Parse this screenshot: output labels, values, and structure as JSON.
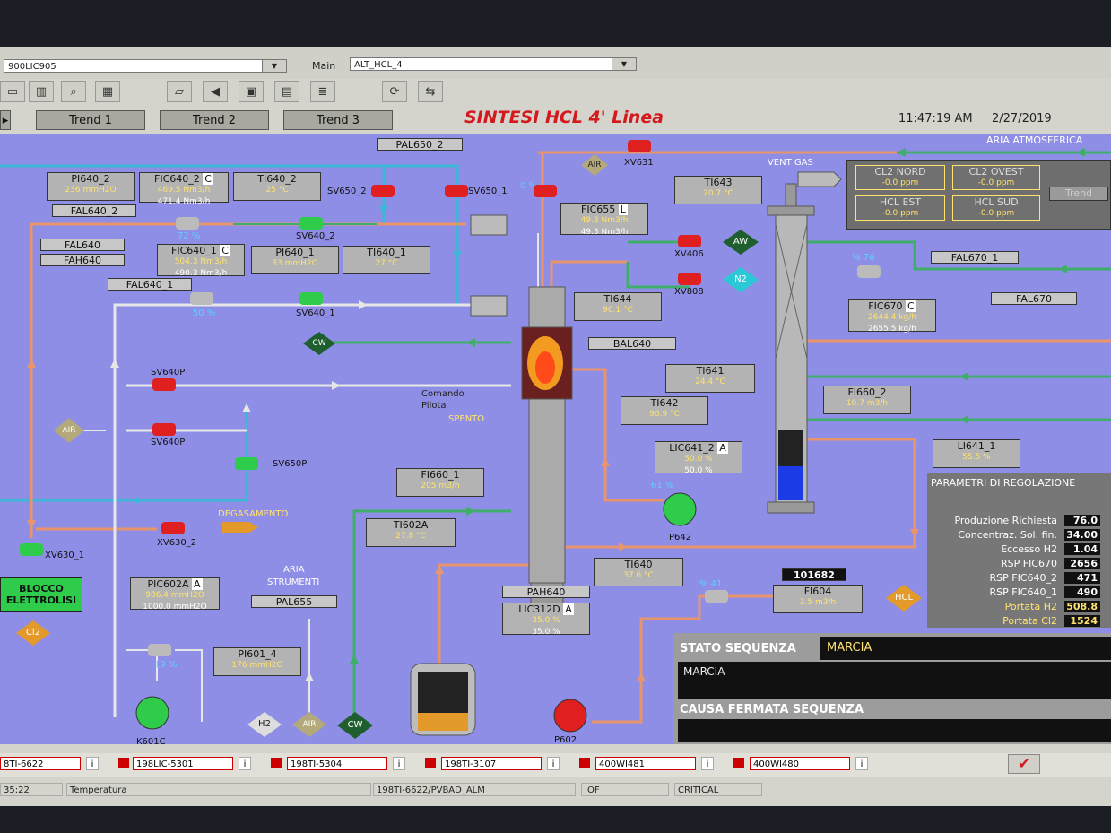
{
  "topbar": {
    "station_combo": "900LIC905",
    "main_label": "Main",
    "main_combo": "ALT_HCL_4"
  },
  "tabs": [
    "Trend 1",
    "Trend 2",
    "Trend 3"
  ],
  "title": "SINTESI HCL 4' Linea",
  "clock": {
    "time": "11:47:19 AM",
    "date": "2/27/2019"
  },
  "air_label": "ARIA ATMOSFERICA",
  "vent_label": "VENT GAS",
  "gas_box": {
    "cl2_nord": {
      "label": "CL2 NORD",
      "value": "-0.0 ppm"
    },
    "cl2_ovest": {
      "label": "CL2 OVEST",
      "value": "-0.0 ppm"
    },
    "hcl_est": {
      "label": "HCL EST",
      "value": "-0.0 ppm"
    },
    "hcl_sud": {
      "label": "HCL SUD",
      "value": "-0.0 ppm"
    },
    "trend_btn": "Trend"
  },
  "tags": {
    "pi640_2": {
      "name": "PI640_2",
      "value": "236 mmH2O"
    },
    "fic640_2": {
      "name": "FIC640_2",
      "mode": "C",
      "v1": "469.5 Nm3/h",
      "v2": "471.4 Nm3/h"
    },
    "ti640_2": {
      "name": "TI640_2",
      "value": "25 °C"
    },
    "fic640_1": {
      "name": "FIC640_1",
      "mode": "C",
      "v1": "504.3 Nm3/h",
      "v2": "490.3 Nm3/h"
    },
    "pi640_1": {
      "name": "PI640_1",
      "value": "83 mmH2O"
    },
    "ti640_1": {
      "name": "TI640_1",
      "value": "27 °C"
    },
    "fic655": {
      "name": "FIC655",
      "mode": "L",
      "v1": "49.3 Nm3/h",
      "v2": "49.3 Nm3/h"
    },
    "ti643": {
      "name": "TI643",
      "value": "20.7 °C"
    },
    "ti644": {
      "name": "TI644",
      "value": "90.1 °C"
    },
    "ti641": {
      "name": "TI641",
      "value": "24.4 °C"
    },
    "ti642": {
      "name": "TI642",
      "value": "90.9 °C"
    },
    "fic670": {
      "name": "FIC670",
      "mode": "C",
      "v1": "2644.4 kg/h",
      "v2": "2655.5 kg/h"
    },
    "fi660_2": {
      "name": "FI660_2",
      "value": "10.7 m3/h"
    },
    "li641_1": {
      "name": "LI641_1",
      "value": "55.5 %"
    },
    "lic641_2": {
      "name": "LIC641_2",
      "mode": "A",
      "v1": "50.0 %",
      "v2": "50.0 %"
    },
    "fi660_1": {
      "name": "FI660_1",
      "value": "205 m3/h"
    },
    "ti602a": {
      "name": "TI602A",
      "value": "27.8 °C"
    },
    "ti640": {
      "name": "TI640",
      "value": "37.6 °C"
    },
    "fi604": {
      "name": "FI604",
      "value": "3.5 m3/h"
    },
    "pic602a": {
      "name": "PIC602A",
      "mode": "A",
      "v1": "986.4 mmH2O",
      "v2": "1000.0 mmH2O"
    },
    "pi601_4": {
      "name": "PI601_4",
      "value": "176 mmH2O"
    },
    "lic312d": {
      "name": "LIC312D",
      "mode": "A",
      "v1": "35.0 %",
      "v2": "35.0 %"
    }
  },
  "flags": {
    "pal650_2": "PAL650_2",
    "fal640_2": "FAL640_2",
    "fal640": "FAL640",
    "fah640": "FAH640",
    "fal640_1": "FAL640_1",
    "bal640": "BAL640",
    "fal670_1": "FAL670_1",
    "fal670": "FAL670",
    "pal655": "PAL655",
    "pah640": "PAH640",
    "counter": "101682"
  },
  "labels": {
    "sv650_2": "SV650_2",
    "sv650_1": "SV650_1",
    "sv640_2": "SV640_2",
    "sv640_1": "SV640_1",
    "xv631": "XV631",
    "xv406": "XV406",
    "xv808": "XV808",
    "sv640p_a": "SV640P",
    "sv640p_b": "SV640P",
    "sv650p": "SV650P",
    "xv630_2": "XV630_2",
    "xv630_1": "XV630_1",
    "degasamento": "DEGASAMENTO",
    "comando": "Comando",
    "pilota": "Pilota",
    "spento": "SPENTO",
    "aria_strumenti_1": "ARIA",
    "aria_strumenti_2": "STRUMENTI",
    "p642": "P642",
    "p602": "P602",
    "k601c": "K601C",
    "pct_72": "72 %",
    "pct_50": "50 %",
    "pct_0": "0 %",
    "pct_76": "% 76",
    "pct_19": "19 %",
    "pct_41": "% 41",
    "pct_60": "61 %",
    "blocco_1": "BLOCCO",
    "blocco_2": "ELETTROLISI",
    "c": "C",
    "a": "A"
  },
  "diamonds": {
    "air": "AIR",
    "cw1": "CW",
    "aw": "AW",
    "n2": "N2",
    "hcl": "HCL",
    "cl2": "Cl2",
    "h2": "H2",
    "cw2": "CW",
    "air2": "AIR"
  },
  "params": {
    "title": "PARAMETRI DI REGOLAZIONE",
    "rows": [
      {
        "k": "Produzione Richiesta",
        "v": "76.0",
        "color": "#fff"
      },
      {
        "k": "Concentraz. Sol. fin.",
        "v": "34.00",
        "color": "#fff"
      },
      {
        "k": "Eccesso H2",
        "v": "1.04",
        "color": "#fff"
      },
      {
        "k": "RSP FIC670",
        "v": "2656",
        "color": "#fff"
      },
      {
        "k": "RSP FIC640_2",
        "v": "471",
        "color": "#fff"
      },
      {
        "k": "RSP FIC640_1",
        "v": "490",
        "color": "#fff"
      },
      {
        "k": "Portata H2",
        "v": "508.8",
        "color": "#ffe36e"
      },
      {
        "k": "Portata Cl2",
        "v": "1524",
        "color": "#ffe36e"
      }
    ]
  },
  "sequence": {
    "state_label": "STATO SEQUENZA",
    "state_value": "MARCIA",
    "state_text": "MARCIA",
    "cause_label": "CAUSA FERMATA SEQUENZA"
  },
  "alarms": [
    "8TI-6622",
    "198LIC-5301",
    "198TI-5304",
    "198TI-3107",
    "400WI481",
    "400WI480"
  ],
  "alarm_info": "i",
  "status": {
    "time": "35:22",
    "desc": "Temperatura",
    "tag": "198TI-6622/PVBAD_ALM",
    "code": "IOF",
    "prio": "CRITICAL"
  },
  "colors": {
    "hmi_bg": "#8f8ee6",
    "title_red": "#d3181e",
    "value_yellow": "#ffe36e",
    "pipe_cyan": "#3cb8d6",
    "pipe_green": "#3fae6a",
    "pipe_salmon": "#e8956e"
  }
}
